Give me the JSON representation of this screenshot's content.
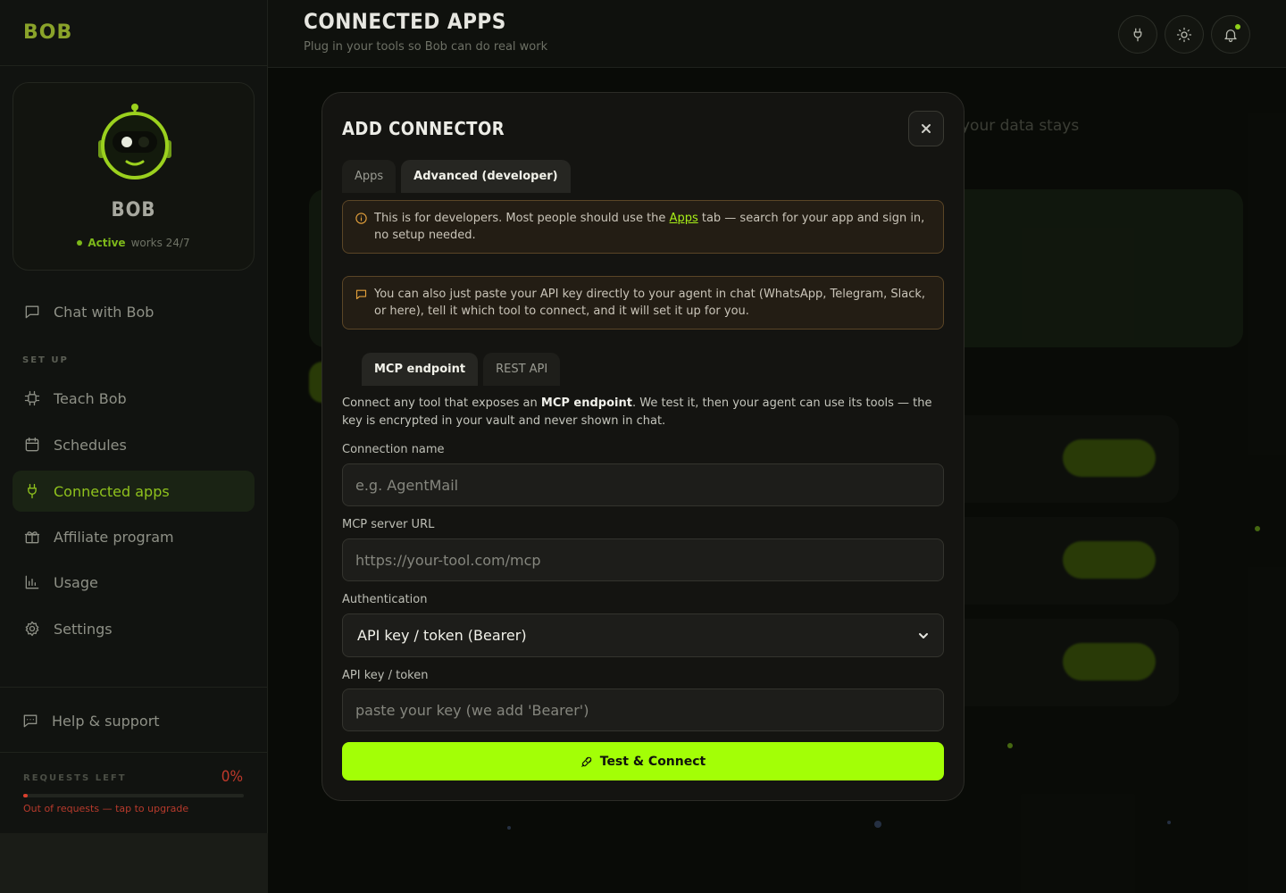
{
  "sidebar": {
    "logo": "BOB",
    "profile": {
      "name": "BOB",
      "status": "Active",
      "availability": "works 24/7"
    },
    "chat_item": "Chat with Bob",
    "section_label": "SET UP",
    "items": [
      {
        "label": "Teach Bob",
        "icon": "chip-icon"
      },
      {
        "label": "Schedules",
        "icon": "calendar-icon"
      },
      {
        "label": "Connected apps",
        "icon": "plug-icon",
        "active": true
      },
      {
        "label": "Affiliate program",
        "icon": "gift-icon"
      },
      {
        "label": "Usage",
        "icon": "bar-chart-icon"
      },
      {
        "label": "Settings",
        "icon": "gear-icon"
      }
    ],
    "help": "Help & support",
    "requests": {
      "label": "REQUESTS LEFT",
      "percent": "0%",
      "note": "Out of requests — tap to upgrade"
    }
  },
  "header": {
    "title": "CONNECTED APPS",
    "subtitle": "Plug in your tools so Bob can do real work"
  },
  "background": {
    "hint": "your data stays"
  },
  "modal": {
    "title": "ADD CONNECTOR",
    "tabs": [
      "Apps",
      "Advanced (developer)"
    ],
    "notice1_text": "This is for developers. Most people should use the ",
    "notice1_link": "Apps",
    "notice1_rest": " tab — search for your app and sign in, no setup needed.",
    "notice2": "You can also just paste your API key directly to your agent in chat (WhatsApp, Telegram, Slack, or here), tell it which tool to connect, and it will set it up for you.",
    "subtabs": [
      "MCP endpoint",
      "REST API"
    ],
    "desc_prefix": "Connect any tool that exposes an ",
    "desc_bold": "MCP endpoint",
    "desc_suffix": ". We test it, then your agent can use its tools — the key is encrypted in your vault and never shown in chat.",
    "fields": {
      "name_label": "Connection name",
      "name_placeholder": "e.g. AgentMail",
      "url_label": "MCP server URL",
      "url_placeholder": "https://your-tool.com/mcp",
      "auth_label": "Authentication",
      "auth_value": "API key / token (Bearer)",
      "key_label": "API key / token",
      "key_placeholder": "paste your key (we add 'Bearer')"
    },
    "submit": "Test & Connect"
  },
  "colors": {
    "accent": "#a3ff06",
    "active_nav": "#8fc21d",
    "danger": "#d9402e",
    "notice_border": "#5a4526"
  }
}
